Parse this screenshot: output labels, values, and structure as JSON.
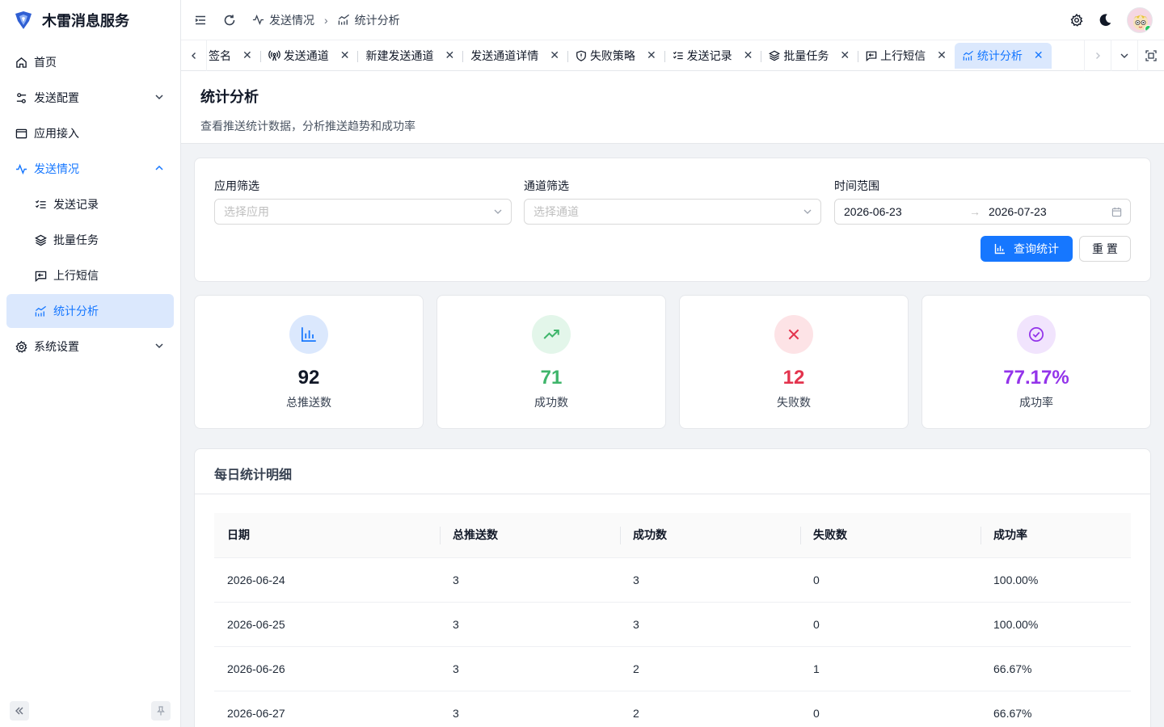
{
  "app": {
    "title": "木雷消息服务"
  },
  "sidebar": {
    "items": [
      {
        "label": "首页",
        "icon": "home-icon"
      },
      {
        "label": "发送配置",
        "icon": "sliders-icon"
      },
      {
        "label": "应用接入",
        "icon": "window-icon"
      },
      {
        "label": "发送情况",
        "icon": "activity-icon"
      },
      {
        "label": "发送记录",
        "icon": "list-check-icon"
      },
      {
        "label": "批量任务",
        "icon": "layers-icon"
      },
      {
        "label": "上行短信",
        "icon": "message-reply-icon"
      },
      {
        "label": "统计分析",
        "icon": "chart-line-icon"
      },
      {
        "label": "系统设置",
        "icon": "gear-icon"
      }
    ]
  },
  "header": {
    "breadcrumb": [
      "发送情况",
      "统计分析"
    ]
  },
  "tabs": [
    {
      "label": "签名"
    },
    {
      "label": "发送通道"
    },
    {
      "label": "新建发送通道"
    },
    {
      "label": "发送通道详情"
    },
    {
      "label": "失败策略"
    },
    {
      "label": "发送记录"
    },
    {
      "label": "批量任务"
    },
    {
      "label": "上行短信"
    },
    {
      "label": "统计分析"
    }
  ],
  "page": {
    "title": "统计分析",
    "subtitle": "查看推送统计数据，分析推送趋势和成功率"
  },
  "filters": {
    "app_label": "应用筛选",
    "app_placeholder": "选择应用",
    "channel_label": "通道筛选",
    "channel_placeholder": "选择通道",
    "range_label": "时间范围",
    "range_start": "2026-06-23",
    "range_end": "2026-07-23",
    "query_button": "查询统计",
    "reset_button": "重 置"
  },
  "stats": [
    {
      "value": "92",
      "label": "总推送数",
      "color": "#111827",
      "bg": "#dbe8fd",
      "icon": "bar-chart-icon"
    },
    {
      "value": "71",
      "label": "成功数",
      "color": "#3fb56b",
      "bg": "#e3f6ea",
      "icon": "trending-up-icon"
    },
    {
      "value": "12",
      "label": "失败数",
      "color": "#e3334d",
      "bg": "#fde3e6",
      "icon": "x-icon"
    },
    {
      "value": "77.17%",
      "label": "成功率",
      "color": "#9333ea",
      "bg": "#f1e4fd",
      "icon": "check-circle-icon"
    }
  ],
  "daily": {
    "title": "每日统计明细",
    "columns": [
      "日期",
      "总推送数",
      "成功数",
      "失败数",
      "成功率"
    ],
    "rows": [
      [
        "2026-06-24",
        "3",
        "3",
        "0",
        "100.00%"
      ],
      [
        "2026-06-25",
        "3",
        "3",
        "0",
        "100.00%"
      ],
      [
        "2026-06-26",
        "3",
        "2",
        "1",
        "66.67%"
      ],
      [
        "2026-06-27",
        "3",
        "2",
        "0",
        "66.67%"
      ]
    ]
  }
}
